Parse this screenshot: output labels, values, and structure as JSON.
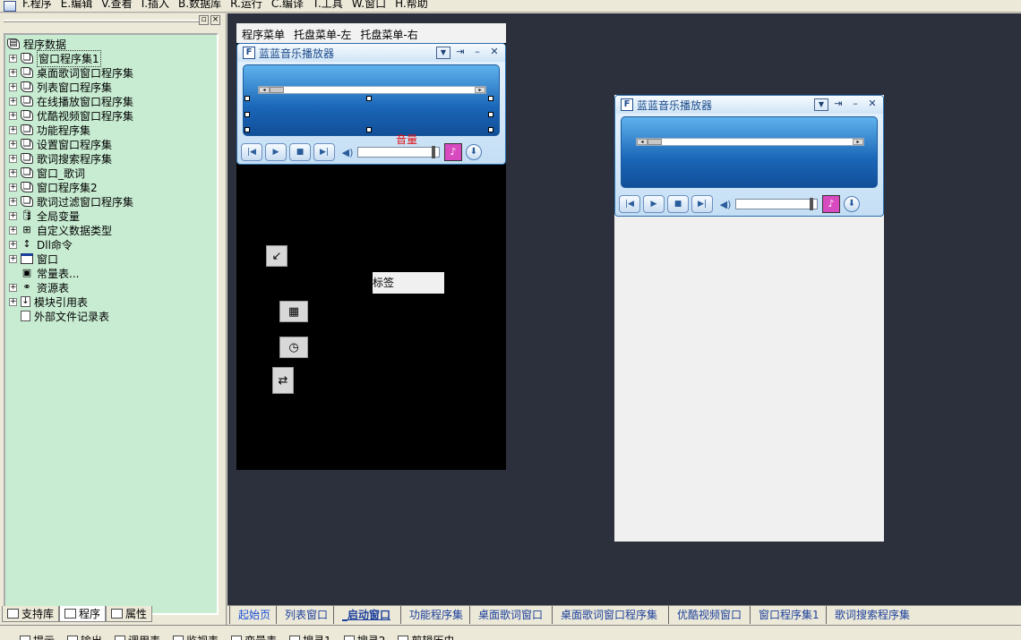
{
  "menu": [
    "F.程序",
    "E.编辑",
    "V.查看",
    "I.插入",
    "B.数据库",
    "R.运行",
    "C.编译",
    "T.工具",
    "W.窗口",
    "H.帮助"
  ],
  "tree": {
    "root": "程序数据",
    "items": [
      {
        "label": "窗口程序集1",
        "icon": "book-icon",
        "expand": true,
        "selected": true
      },
      {
        "label": "桌面歌词窗口程序集",
        "icon": "book-icon",
        "expand": true
      },
      {
        "label": "列表窗口程序集",
        "icon": "book-icon",
        "expand": true
      },
      {
        "label": "在线播放窗口程序集",
        "icon": "book-icon",
        "expand": true
      },
      {
        "label": "优酷视频窗口程序集",
        "icon": "book-icon",
        "expand": true
      },
      {
        "label": "功能程序集",
        "icon": "book-icon",
        "expand": true
      },
      {
        "label": "设置窗口程序集",
        "icon": "book-icon",
        "expand": true
      },
      {
        "label": "歌词搜索程序集",
        "icon": "book-icon",
        "expand": true
      },
      {
        "label": "窗口_歌词",
        "icon": "book-icon",
        "expand": true
      },
      {
        "label": "窗口程序集2",
        "icon": "book-icon",
        "expand": true
      },
      {
        "label": "歌词过滤窗口程序集",
        "icon": "book-icon",
        "expand": true
      },
      {
        "label": "全局变量",
        "icon": "variable-icon",
        "expand": true
      },
      {
        "label": "自定义数据类型",
        "icon": "datatype-icon",
        "expand": true
      },
      {
        "label": "Dll命令",
        "icon": "dll-icon",
        "expand": true
      },
      {
        "label": "窗口",
        "icon": "window-icon",
        "expand": true
      },
      {
        "label": "常量表...",
        "icon": "constant-icon",
        "expand": false
      },
      {
        "label": "资源表",
        "icon": "resource-icon",
        "expand": true
      },
      {
        "label": "模块引用表",
        "icon": "module-icon",
        "expand": true
      },
      {
        "label": "外部文件记录表",
        "icon": "document-icon",
        "expand": false
      }
    ]
  },
  "left_tabs": [
    "支持库",
    "程序",
    "属性"
  ],
  "form1": {
    "menu": [
      "程序菜单",
      "托盘菜单-左",
      "托盘菜单-右"
    ],
    "volume_label": "音量",
    "label_control": "标签"
  },
  "player": {
    "title": "蓝蓝音乐播放器",
    "icon_letter": "F"
  },
  "doc_tabs": [
    "起始页",
    "列表窗口",
    "_启动窗口",
    "功能程序集",
    "桌面歌词窗口",
    "桌面歌词窗口程序集",
    "优酷视频窗口",
    "窗口程序集1",
    "歌词搜索程序集"
  ],
  "status": [
    "提示",
    "输出",
    "调用表",
    "监视表",
    "变量表",
    "搜寻1",
    "搜寻2",
    "剪辑历史"
  ]
}
